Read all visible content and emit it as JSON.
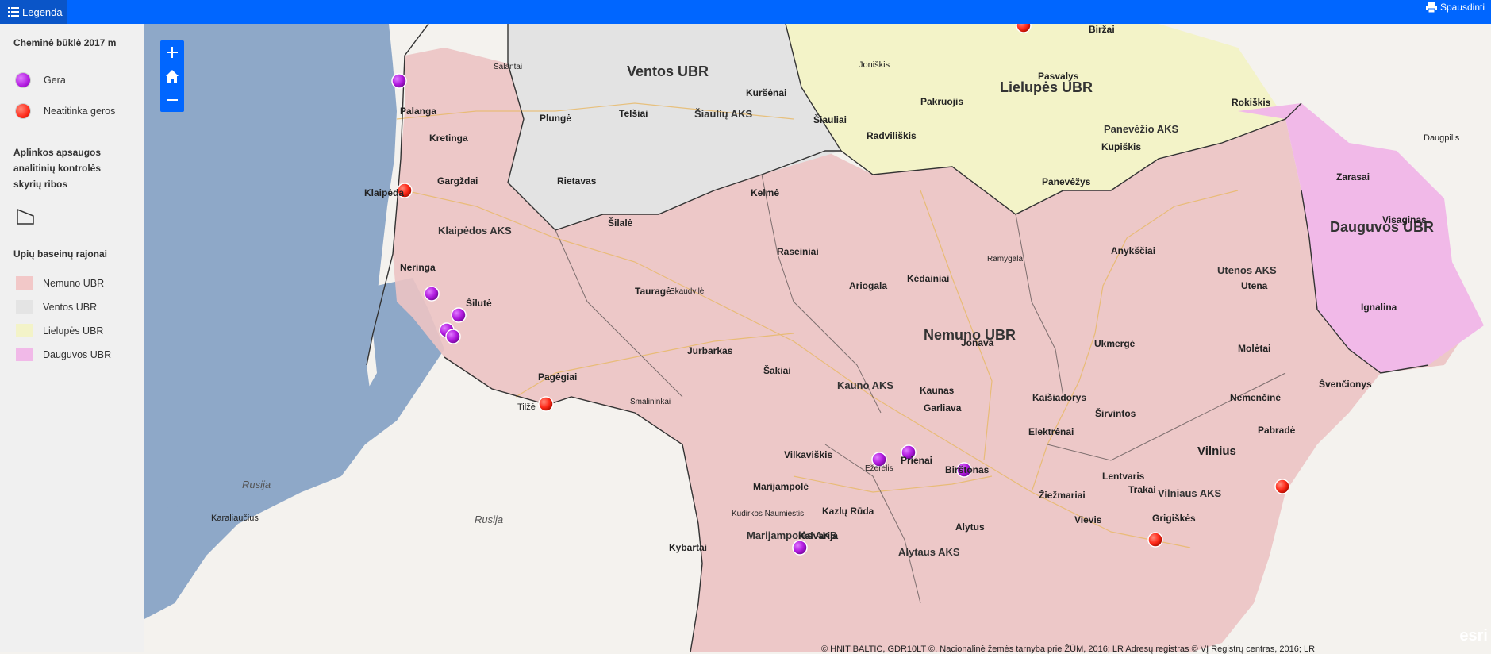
{
  "toolbar": {
    "legend_label": "Legenda",
    "print_label": "Spausdinti"
  },
  "legend": {
    "title": "Cheminė būklė 2017 m",
    "items": [
      {
        "label": "Gera",
        "color": "#b21be0"
      },
      {
        "label": "Neatitinka geros",
        "color": "#ff2a1a"
      }
    ],
    "boundary_title_1": "Aplinkos apsaugos",
    "boundary_title_2": "analitinių kontrolės",
    "boundary_title_3": "skyrių ribos",
    "basins_title": "Upių baseinų rajonai",
    "basins": [
      {
        "label": "Nemuno UBR",
        "color": "#f2c8c8"
      },
      {
        "label": "Ventos UBR",
        "color": "#e4e4e4"
      },
      {
        "label": "Lielupės UBR",
        "color": "#f3f3c8"
      },
      {
        "label": "Dauguvos UBR",
        "color": "#f1b9e8"
      }
    ]
  },
  "map": {
    "ubr_labels": [
      "Ventos UBR",
      "Lielupės UBR",
      "Nemuno UBR",
      "Dauguvos UBR"
    ],
    "aks_labels": [
      "Šiaulių AKS",
      "Panevėžio AKS",
      "Klaipėdos AKS",
      "Utenos AKS",
      "Kauno AKS",
      "Marijampolės AKS",
      "Alytaus AKS",
      "Vilniaus AKS"
    ],
    "cities": [
      "Palanga",
      "Kretinga",
      "Gargždai",
      "Klaipėda",
      "Neringa",
      "Šilutė",
      "Pagėgiai",
      "Plungė",
      "Rietavas",
      "Telšiai",
      "Šiauliai",
      "Kuršėnai",
      "Radviliškis",
      "Kelmė",
      "Šilalė",
      "Tauragė",
      "Raseiniai",
      "Jurbarkas",
      "Šakiai",
      "Kėdainiai",
      "Jonava",
      "Kaunas",
      "Garliava",
      "Kaišiadorys",
      "Elektrėnai",
      "Vilkaviškis",
      "Marijampolė",
      "Kalvarija",
      "Prienai",
      "Birštonas",
      "Alytus",
      "Trakai",
      "Lentvaris",
      "Vilnius",
      "Nemenčinė",
      "Pabradė",
      "Švenčionys",
      "Molėtai",
      "Utena",
      "Anykščiai",
      "Ukmergė",
      "Širvintos",
      "Panevėžys",
      "Pasvalys",
      "Biržai",
      "Rokiškis",
      "Kupiškis",
      "Zarasai",
      "Visaginas",
      "Ignalina",
      "Joniškis",
      "Pakruojis",
      "Ariogala",
      "Kybartai",
      "Ežerėlis",
      "Kazlų Rūda",
      "Vievis",
      "Grigiškės",
      "Žiežmariai",
      "Ramygala",
      "Salantai",
      "Skaudvilė",
      "Smalininkai",
      "Tilžė",
      "Kudirkos Naumiestis",
      "Karaliaučius",
      "Daugpilis"
    ],
    "countries": [
      "Rusija",
      "Rusija"
    ],
    "attribution": "© HNIT BALTIC, GDR10LT ©, Nacionalinė žemės tarnyba prie ŽŪM, 2016; LR Adresų registras © VĮ Registrų centras, 2016; LR",
    "logo": "esri"
  }
}
